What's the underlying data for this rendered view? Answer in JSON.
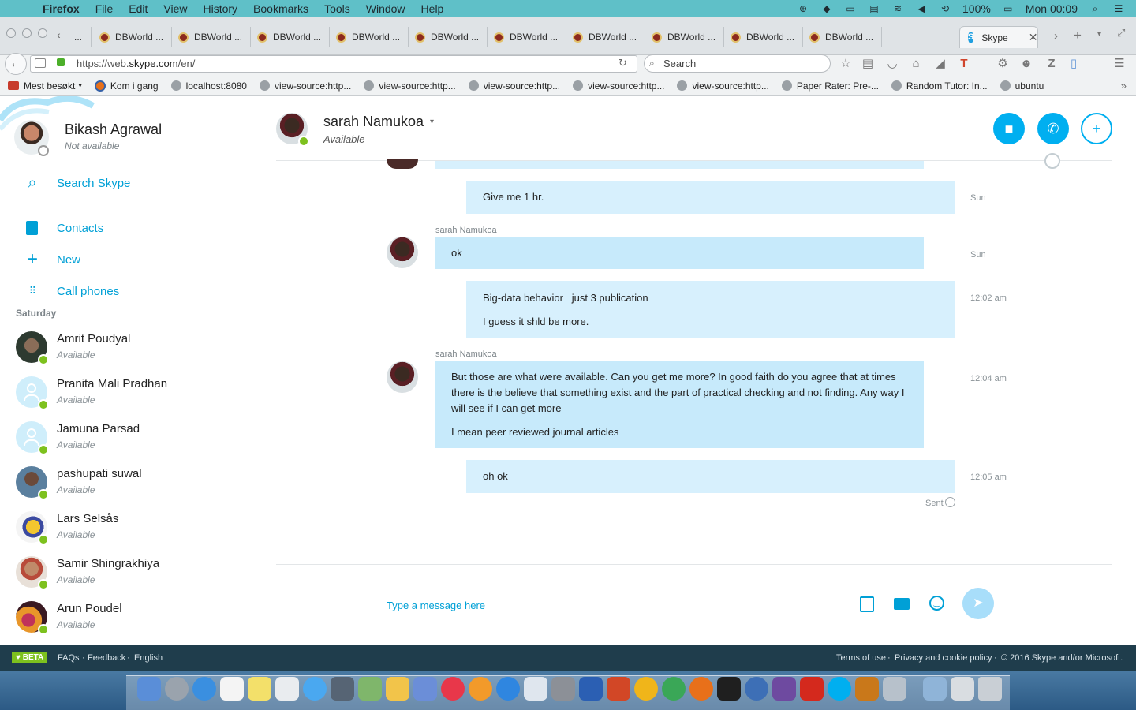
{
  "menubar": {
    "app": "Firefox",
    "items": [
      "File",
      "Edit",
      "View",
      "History",
      "Bookmarks",
      "Tools",
      "Window",
      "Help"
    ],
    "battery": "100%",
    "clock": "Mon 00:09"
  },
  "tabs": {
    "first_partial": "...",
    "items": [
      "DBWorld ...",
      "DBWorld ...",
      "DBWorld ...",
      "DBWorld ...",
      "DBWorld ...",
      "DBWorld ...",
      "DBWorld ...",
      "DBWorld ...",
      "DBWorld ...",
      "DBWorld ..."
    ],
    "active": "Skype"
  },
  "navbar": {
    "url_prefix": "https://web.",
    "url_domain": "skype.com",
    "url_suffix": "/en/",
    "search_placeholder": "Search"
  },
  "bookmarks": [
    "Mest besøkt",
    "Kom i gang",
    "localhost:8080",
    "view-source:http...",
    "view-source:http...",
    "view-source:http...",
    "view-source:http...",
    "view-source:http...",
    "Paper Rater: Pre-...",
    "Random Tutor: In...",
    "ubuntu"
  ],
  "profile": {
    "name": "Bikash Agrawal",
    "status": "Not available"
  },
  "sidebar": {
    "search": "Search Skype",
    "contacts": "Contacts",
    "new": "New",
    "call_phones": "Call phones",
    "section": "Saturday",
    "contacts_list": [
      {
        "name": "Amrit Poudyal",
        "status": "Available"
      },
      {
        "name": "Pranita Mali Pradhan",
        "status": "Available"
      },
      {
        "name": "Jamuna Parsad",
        "status": "Available"
      },
      {
        "name": "pashupati suwal",
        "status": "Available"
      },
      {
        "name": "Lars Selsås",
        "status": "Available"
      },
      {
        "name": "Samir Shingrakhiya",
        "status": "Available"
      },
      {
        "name": "Arun Poudel",
        "status": "Available"
      }
    ]
  },
  "chat": {
    "name": "sarah Namukoa",
    "status": "Available",
    "messages": [
      {
        "text": "Give me 1 hr.",
        "time": "Sun"
      },
      {
        "sender": "sarah Namukoa",
        "text": "ok",
        "time": "Sun"
      },
      {
        "text1": "Big-data behavior   just 3 publication",
        "text2": "I guess it shld be more.",
        "time": "12:02 am"
      },
      {
        "sender": "sarah Namukoa",
        "text1": "But those are what were available. Can you get me more? In good faith do you agree that at times there is the believe that something exist and the part of practical checking and not finding. Any way I will see if I can get more",
        "text2": "I mean peer reviewed journal articles",
        "time": "12:04 am"
      },
      {
        "text": "oh ok",
        "time": "12:05 am"
      }
    ],
    "sent": "Sent",
    "composer_placeholder": "Type a message here"
  },
  "footer": {
    "beta": "♥ BETA",
    "faqs": "FAQs",
    "feedback": "Feedback",
    "language": "English",
    "terms": "Terms of use",
    "privacy": "Privacy and cookie policy",
    "copyright": "© 2016 Skype and/or Microsoft."
  },
  "colors": {
    "skype_blue": "#00aff0",
    "link": "#00a0d6",
    "incoming_bubble": "#c7eafb",
    "outgoing_bubble": "#d7f0fd",
    "presence": "#7dc11e"
  }
}
